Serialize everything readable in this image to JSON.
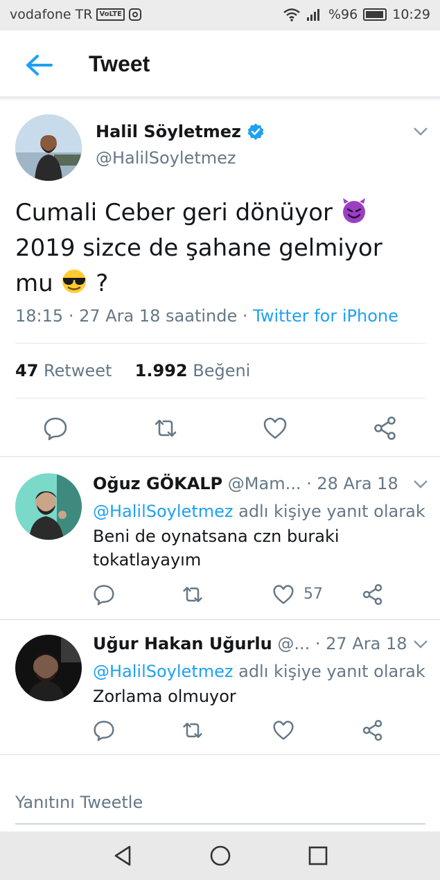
{
  "status_bar": {
    "carrier": "vodafone TR",
    "volte": "VoLTE",
    "battery_text": "%96",
    "battery_level": 0.96,
    "time": "10:29"
  },
  "header": {
    "title": "Tweet"
  },
  "tweet": {
    "author_name": "Halil Söyletmez",
    "author_handle": "@HalilSoyletmez",
    "text_line1": "Cumali Ceber geri dönüyor",
    "text_line2": "2019 sizce de şahane gelmiyor",
    "text_line3_a": "mu",
    "text_line3_b": "?",
    "time": "18:15",
    "date": "27 Ara 18 saatinde",
    "source": "Twitter for iPhone",
    "retweets": "47",
    "retweets_label": "Retweet",
    "likes": "1.992",
    "likes_label": "Beğeni"
  },
  "replies": [
    {
      "name": "Oğuz GÖKALP",
      "handle": "@Mam...",
      "date": "· 28 Ara 18",
      "reply_to_mention": "@HalilSoyletmez",
      "reply_to_suffix": "adlı kişiye yanıt olarak",
      "body": "Beni de oynatsana czn buraki tokatlayayım",
      "like_count": "57"
    },
    {
      "name": "Uğur Hakan Uğurlu",
      "handle": "@...",
      "date": "· 27 Ara 18",
      "reply_to_mention": "@HalilSoyletmez",
      "reply_to_suffix": "adlı kişiye yanıt olarak",
      "body": "Zorlama olmuyor",
      "like_count": ""
    }
  ],
  "reply_box": {
    "placeholder": "Yanıtını Tweetle"
  },
  "colors": {
    "accent": "#1da1f2",
    "secondary_text": "#657786",
    "divider": "#e1e8ed"
  },
  "icons": [
    "back-arrow-icon",
    "verified-badge-icon",
    "chevron-down-icon",
    "reply-icon",
    "retweet-icon",
    "like-icon",
    "share-icon",
    "nav-back-icon",
    "nav-home-icon",
    "nav-recents-icon"
  ]
}
